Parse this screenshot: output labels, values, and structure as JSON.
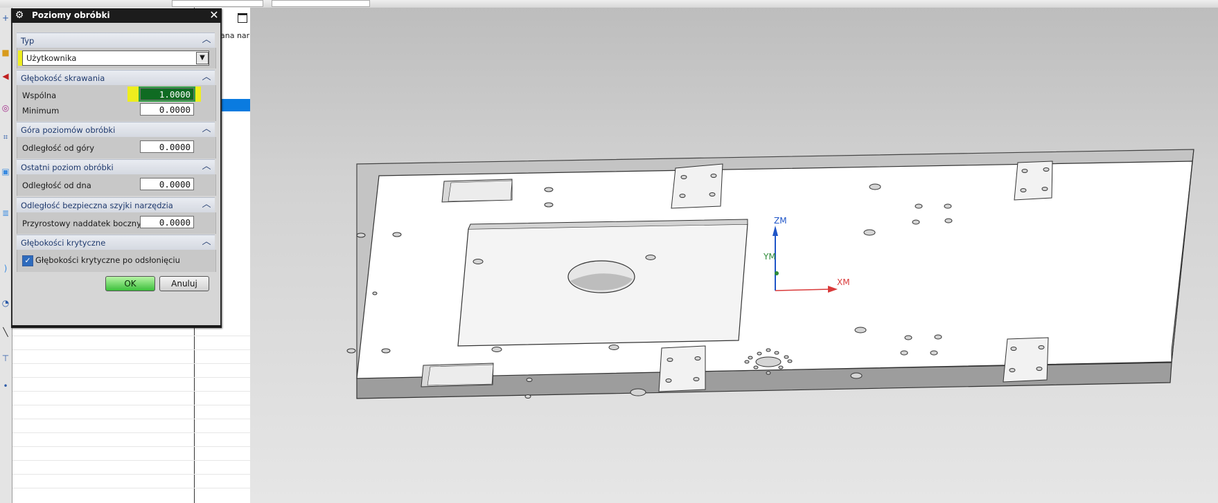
{
  "dialog": {
    "title": "Poziomy obróbki",
    "sections": {
      "type": "Typ",
      "cut_depth": "Głębokość skrawania",
      "top_levels": "Góra poziomów obróbki",
      "last_level": "Ostatni poziom obróbki",
      "holder_clearance": "Odległość bezpieczna szyjki narzędzia",
      "critical_depths": "Głębokości krytyczne"
    },
    "type_value": "Użytkownika",
    "common_label": "Wspólna",
    "common_value": "1.0000",
    "minimum_label": "Minimum",
    "minimum_value": "0.0000",
    "from_top_label": "Odległość od góry",
    "from_top_value": "0.0000",
    "from_bottom_label": "Odległość od dna",
    "from_bottom_value": "0.0000",
    "side_stock_label": "Przyrostowy naddatek boczny",
    "side_stock_value": "0.0000",
    "critical_checkbox_label": "Głębokości krytyczne po odsłonięciu",
    "critical_checked": true,
    "ok": "OK",
    "cancel": "Anuluj"
  },
  "navigator": {
    "column_header": "ana nar"
  },
  "viewport": {
    "axes": {
      "z": "ZM",
      "y": "YM",
      "x": "XM"
    }
  },
  "colors": {
    "highlight": "#f5f500",
    "active_field": "#0f6b22",
    "selection": "#0a7be0",
    "axis_z": "#1f55c8",
    "axis_x": "#d93a3a",
    "axis_y": "#2e8b3a"
  }
}
